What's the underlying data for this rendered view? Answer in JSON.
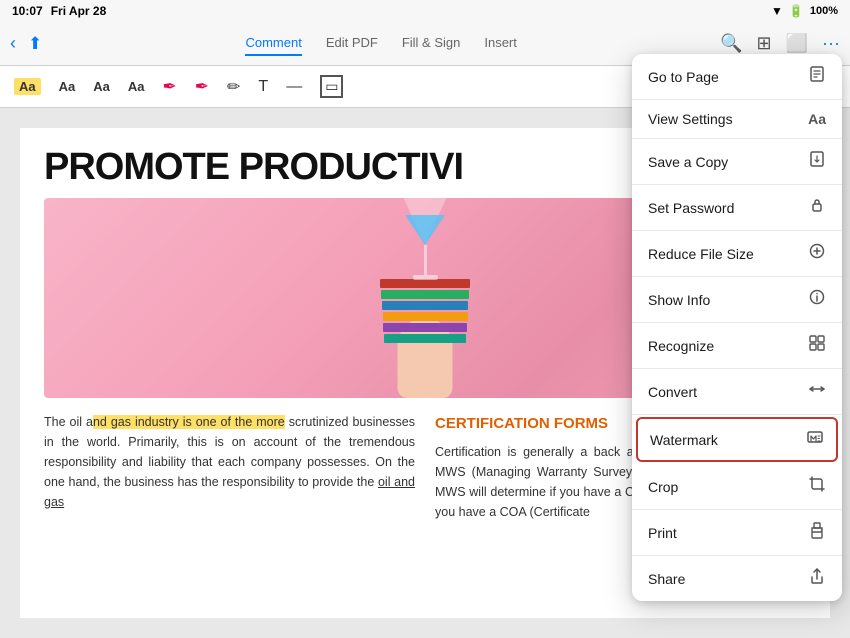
{
  "statusBar": {
    "time": "10:07",
    "day": "Fri Apr 28",
    "battery": "100%",
    "wifi": true
  },
  "toolbar": {
    "tabs": [
      {
        "id": "comment",
        "label": "Comment",
        "active": true
      },
      {
        "id": "edit-pdf",
        "label": "Edit PDF",
        "active": false
      },
      {
        "id": "fill-sign",
        "label": "Fill & Sign",
        "active": false
      },
      {
        "id": "insert",
        "label": "Insert",
        "active": false
      }
    ]
  },
  "annotationBar": {
    "tools": [
      "Aa",
      "Aa",
      "Aa",
      "Aa",
      "🖊",
      "🖊",
      "✏",
      "T",
      "—",
      "▭"
    ]
  },
  "pdf": {
    "title": "PROMOTE PRODUCTIVI",
    "bodyLeft": "The oil and gas industry is one of the more scrutinized businesses in the world. Primarily, this is on account of the tremendous responsibility and liability that each company possesses. On the one hand, the business has the responsibility to provide the oil and gas",
    "highlightText": "nd gas industry is one of the more",
    "sectionTitle": "CERTIFICATION FORMS",
    "bodyRight": "Certification is generally a back and forth of fixes between the MWS (Managing Warranty Surveyor) and the insurer. Since the MWS will determine if you have a COA (Certificate will determine if you have a COA (Certificate"
  },
  "menu": {
    "items": [
      {
        "id": "go-to-page",
        "label": "Go to Page",
        "icon": "⬜",
        "selected": false
      },
      {
        "id": "view-settings",
        "label": "View Settings",
        "icon": "Aa",
        "selected": false
      },
      {
        "id": "save-a-copy",
        "label": "Save a Copy",
        "icon": "📄",
        "selected": false
      },
      {
        "id": "set-password",
        "label": "Set Password",
        "icon": "🔒",
        "selected": false
      },
      {
        "id": "reduce-file-size",
        "label": "Reduce File Size",
        "icon": "⊕",
        "selected": false
      },
      {
        "id": "show-info",
        "label": "Show Info",
        "icon": "ℹ",
        "selected": false
      },
      {
        "id": "recognize",
        "label": "Recognize",
        "icon": "⬜",
        "selected": false
      },
      {
        "id": "convert",
        "label": "Convert",
        "icon": "⇄",
        "selected": false
      },
      {
        "id": "watermark",
        "label": "Watermark",
        "icon": "⬜",
        "selected": true
      },
      {
        "id": "crop",
        "label": "Crop",
        "icon": "⬜",
        "selected": false
      },
      {
        "id": "print",
        "label": "Print",
        "icon": "🖨",
        "selected": false
      },
      {
        "id": "share",
        "label": "Share",
        "icon": "⬆",
        "selected": false
      }
    ]
  }
}
